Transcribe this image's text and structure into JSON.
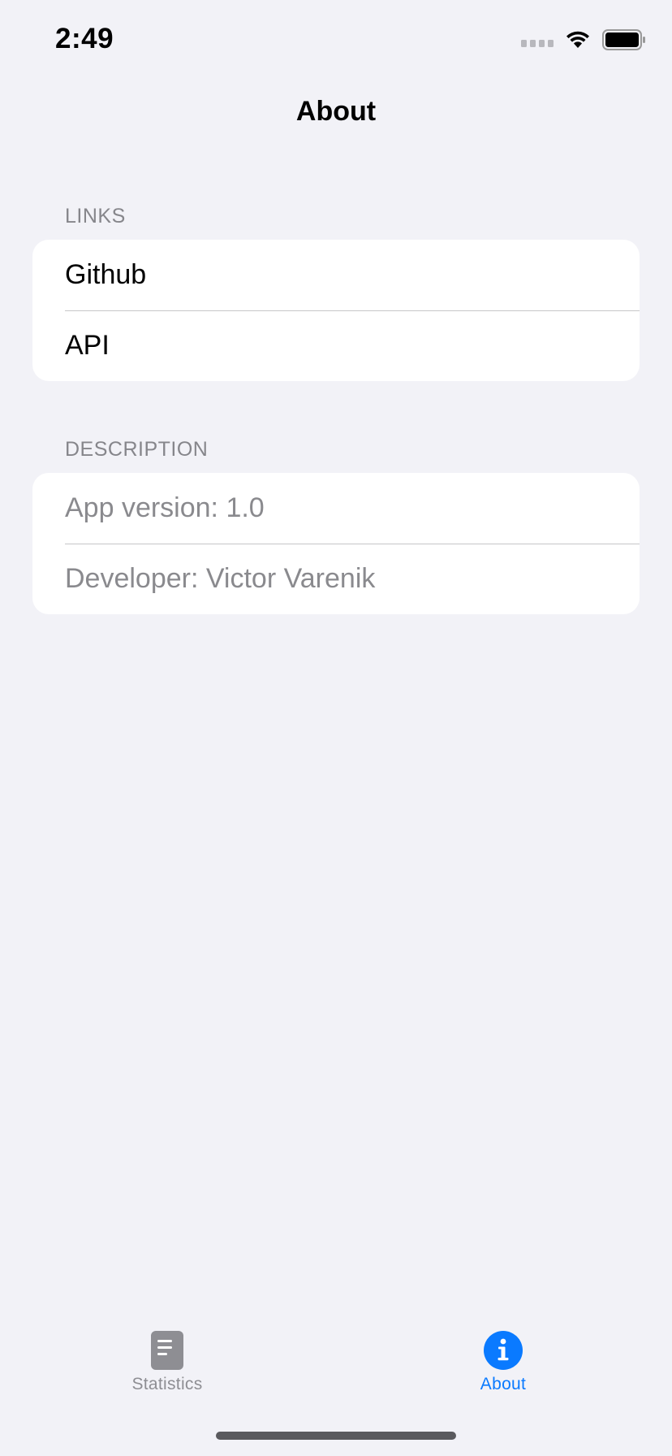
{
  "status_bar": {
    "time": "2:49"
  },
  "nav": {
    "title": "About"
  },
  "sections": {
    "links": {
      "header": "LINKS",
      "items": [
        "Github",
        "API"
      ]
    },
    "description": {
      "header": "DESCRIPTION",
      "items": [
        "App version: 1.0",
        "Developer: Victor Varenik"
      ]
    }
  },
  "tab_bar": {
    "tabs": [
      {
        "label": "Statistics",
        "icon": "document-icon",
        "selected": false
      },
      {
        "label": "About",
        "icon": "info-circle-icon",
        "selected": true
      }
    ]
  },
  "colors": {
    "accent": "#0a7aff",
    "background": "#f2f2f7",
    "secondary_text": "#8a8a8e"
  }
}
